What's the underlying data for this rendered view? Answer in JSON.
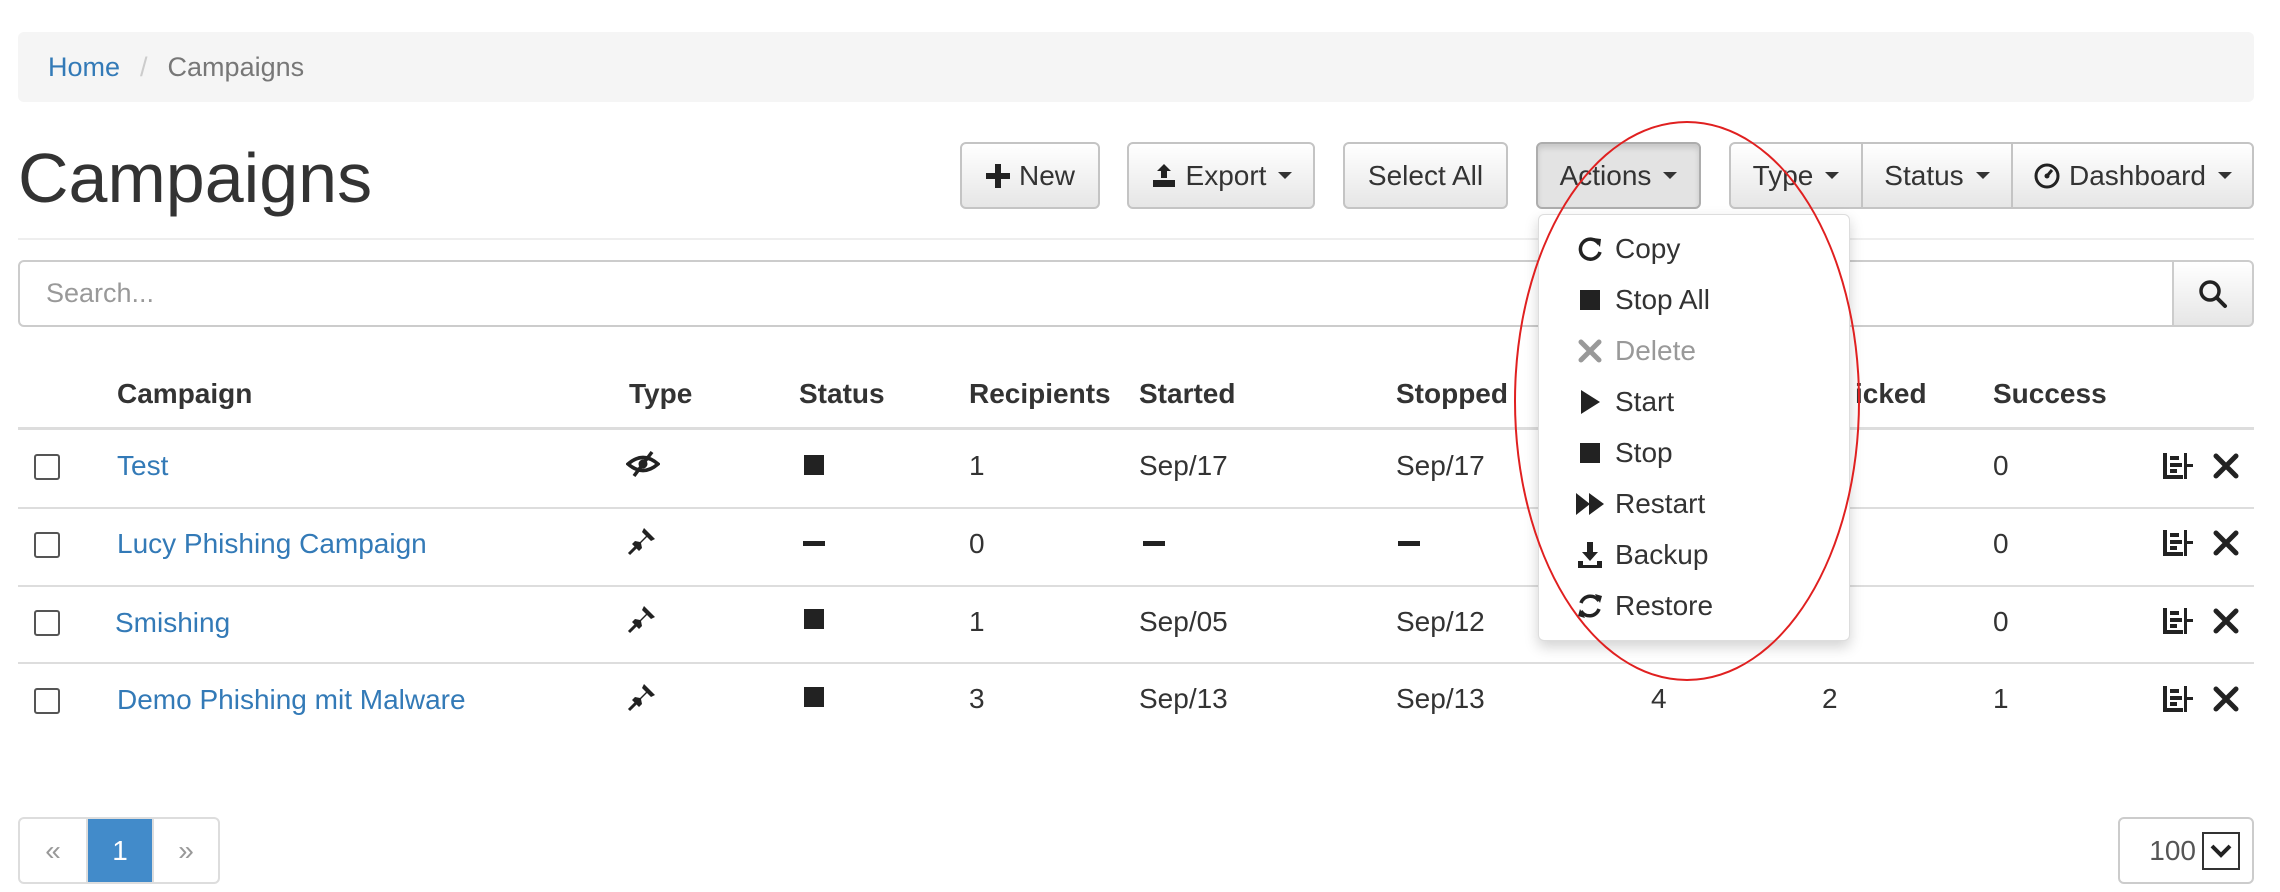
{
  "breadcrumb": {
    "home": "Home",
    "separator": "/",
    "current": "Campaigns"
  },
  "page": {
    "title": "Campaigns"
  },
  "toolbar": {
    "new_label": "New",
    "export_label": "Export",
    "select_all_label": "Select All",
    "actions_label": "Actions",
    "type_label": "Type",
    "status_label": "Status",
    "dashboard_label": "Dashboard"
  },
  "search": {
    "placeholder": "Search...",
    "value": ""
  },
  "table": {
    "columns": {
      "campaign": "Campaign",
      "type": "Type",
      "status": "Status",
      "recipients": "Recipients",
      "started": "Started",
      "stopped": "Stopped",
      "clicked": "icked",
      "success": "Success"
    },
    "rows": [
      {
        "name": "Test",
        "type_icon": "eye-slash-icon",
        "status_icon": "stop-square-icon",
        "recipients": "1",
        "started": "Sep/17",
        "stopped": "Sep/17",
        "col7": "",
        "clicked": "",
        "success": "0"
      },
      {
        "name": "Lucy Phishing Campaign",
        "type_icon": "pushpin-icon",
        "status_icon": "dash-icon",
        "recipients": "0",
        "started": "",
        "stopped": "",
        "col7": "",
        "clicked": "",
        "success": "0"
      },
      {
        "name": "Smishing",
        "type_icon": "pushpin-icon",
        "status_icon": "stop-square-icon",
        "recipients": "1",
        "started": "Sep/05",
        "stopped": "Sep/12",
        "col7": "",
        "clicked": "",
        "success": "0"
      },
      {
        "name": "Demo Phishing mit Malware",
        "type_icon": "pushpin-icon",
        "status_icon": "stop-square-icon",
        "recipients": "3",
        "started": "Sep/13",
        "stopped": "Sep/13",
        "col7": "4",
        "clicked": "2",
        "success": "1"
      }
    ]
  },
  "actions_menu": {
    "items": [
      {
        "label": "Copy",
        "icon": "copy-refresh-icon",
        "disabled": false
      },
      {
        "label": "Stop All",
        "icon": "stop-square-icon",
        "disabled": false
      },
      {
        "label": "Delete",
        "icon": "close-x-icon",
        "disabled": true
      },
      {
        "label": "Start",
        "icon": "play-icon",
        "disabled": false
      },
      {
        "label": "Stop",
        "icon": "stop-square-icon",
        "disabled": false
      },
      {
        "label": "Restart",
        "icon": "fast-forward-icon",
        "disabled": false
      },
      {
        "label": "Backup",
        "icon": "download-icon",
        "disabled": false
      },
      {
        "label": "Restore",
        "icon": "refresh-icon",
        "disabled": false
      }
    ]
  },
  "pagination": {
    "prev": "«",
    "current": "1",
    "next": "»"
  },
  "page_size": {
    "value": "100"
  },
  "colors": {
    "link": "#337ab7",
    "active_page": "#428bca",
    "annotation": "#e02020"
  }
}
